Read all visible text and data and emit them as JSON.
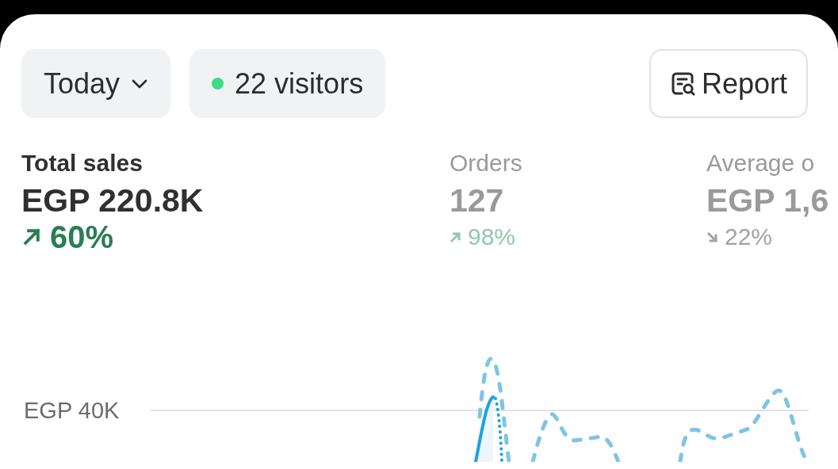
{
  "date_filter": {
    "label": "Today"
  },
  "visitors": {
    "label": "22 visitors",
    "live": true
  },
  "report_button": {
    "label": "Report"
  },
  "metrics": [
    {
      "label": "Total sales",
      "value": "EGP 220.8K",
      "change": "60%",
      "kind": "rise",
      "selected": true
    },
    {
      "label": "Orders",
      "value": "127",
      "change": "98%",
      "kind": "rise",
      "selected": false
    },
    {
      "label": "Average o",
      "value": "EGP 1,6",
      "change": "22%",
      "kind": "fall",
      "selected": false
    }
  ],
  "chart": {
    "y_tick_label": "EGP 40K"
  }
}
